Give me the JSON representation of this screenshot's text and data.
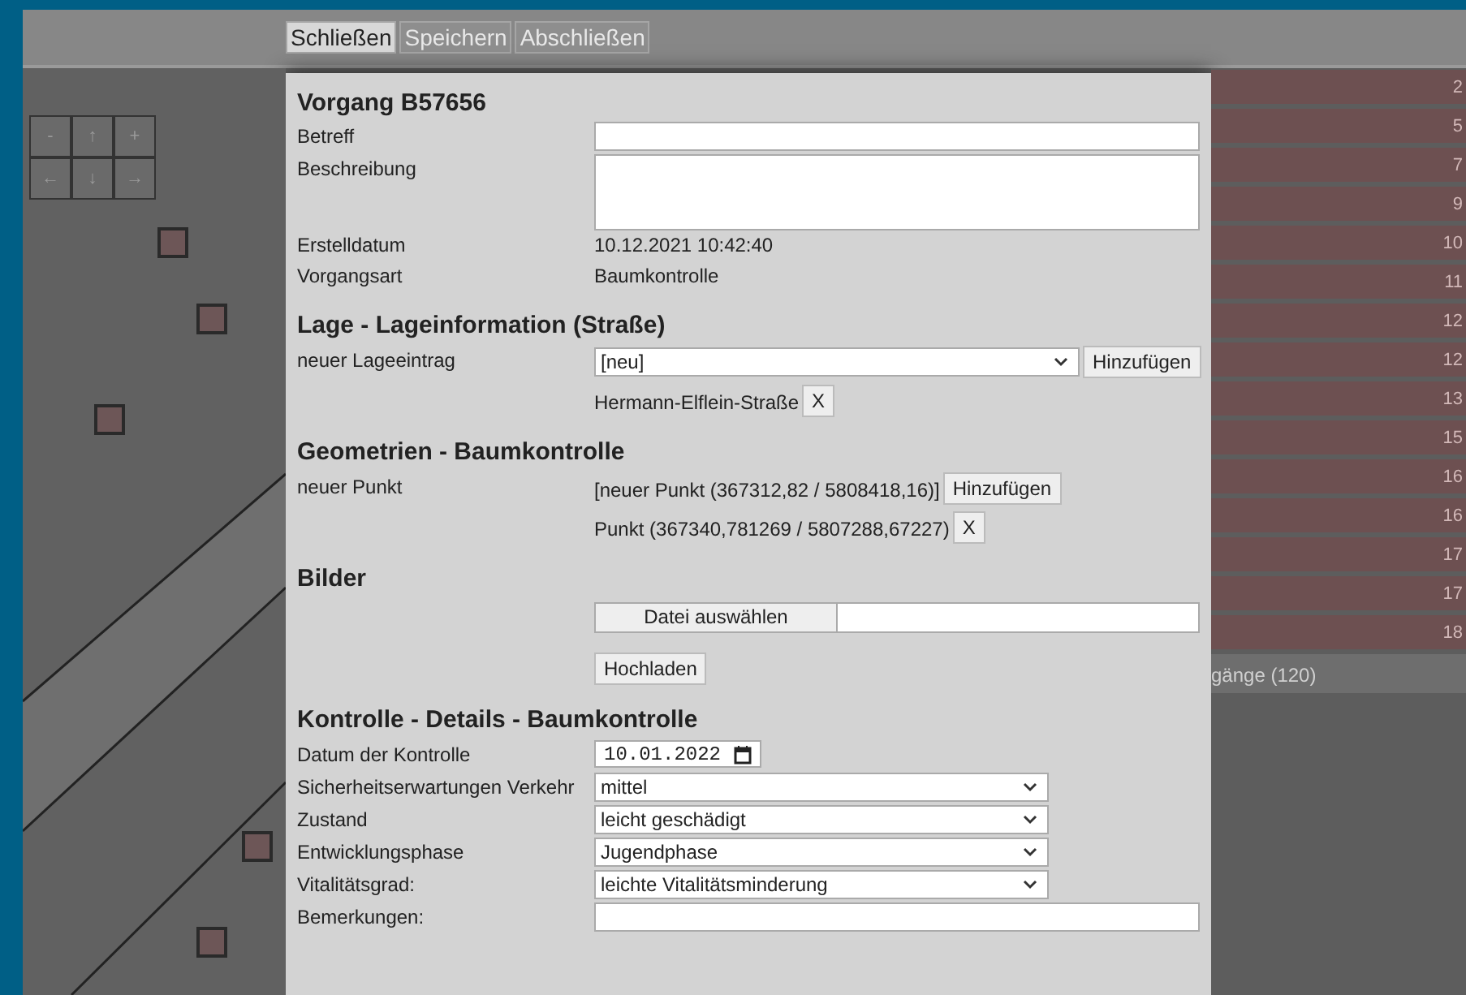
{
  "toolbar": {
    "buttons": [
      {
        "label": "Schließen",
        "selected": true
      },
      {
        "label": "Speichern",
        "selected": false
      },
      {
        "label": "Abschließen",
        "selected": false
      }
    ]
  },
  "map": {
    "nav_buttons": [
      "-",
      "↑",
      "+",
      "←",
      "↓",
      "→"
    ]
  },
  "dialog": {
    "title": "Vorgang B57656",
    "sections": [
      {
        "rows": [
          {
            "kind": "input",
            "label": "Betreff"
          },
          {
            "kind": "textarea",
            "label": "Beschreibung"
          },
          {
            "kind": "text",
            "label": "Erstelldatum",
            "value": "10.12.2021 10:42:40"
          },
          {
            "kind": "text",
            "label": "Vorgangsart",
            "value": "Baumkontrolle"
          }
        ]
      },
      {
        "heading": "Lage - Lageinformation (Straße)",
        "rows": [
          {
            "kind": "select_add",
            "label": "neuer Lageeintrag",
            "value": "[neu]",
            "button": "Hinzufügen"
          },
          {
            "kind": "entry",
            "value": "Hermann-Elflein-Straße",
            "button": "X"
          }
        ]
      },
      {
        "heading": "Geometrien - Baumkontrolle",
        "rows": [
          {
            "kind": "text_add",
            "label": "neuer Punkt",
            "value": "[neuer Punkt (367312,82 / 5808418,16)]",
            "button": "Hinzufügen"
          },
          {
            "kind": "entry",
            "value": "Punkt (367340,781269 / 5807288,67227)",
            "button": "X"
          }
        ]
      },
      {
        "heading": "Bilder",
        "rows": [
          {
            "kind": "file",
            "button": "Datei auswählen"
          },
          {
            "kind": "button",
            "button": "Hochladen"
          }
        ]
      },
      {
        "heading": "Kontrolle - Details - Baumkontrolle",
        "rows": [
          {
            "kind": "date",
            "label": "Datum der Kontrolle",
            "value": "10.01.2022"
          },
          {
            "kind": "select",
            "label": "Sicherheitserwartungen Verkehr",
            "value": "mittel"
          },
          {
            "kind": "select",
            "label": "Zustand",
            "value": "leicht geschädigt"
          },
          {
            "kind": "select",
            "label": "Entwicklungsphase",
            "value": "Jugendphase"
          },
          {
            "kind": "select",
            "label": "Vitalitätsgrad:",
            "value": "leichte Vitalitätsminderung"
          },
          {
            "kind": "input",
            "label": "Bemerkungen:"
          }
        ]
      }
    ]
  },
  "list": {
    "items": [
      "2",
      "5",
      "7",
      "9",
      "10",
      "11",
      "12",
      "12",
      "13",
      "15",
      "16",
      "16",
      "17",
      "17",
      "18"
    ],
    "footer": "gänge (120)"
  }
}
